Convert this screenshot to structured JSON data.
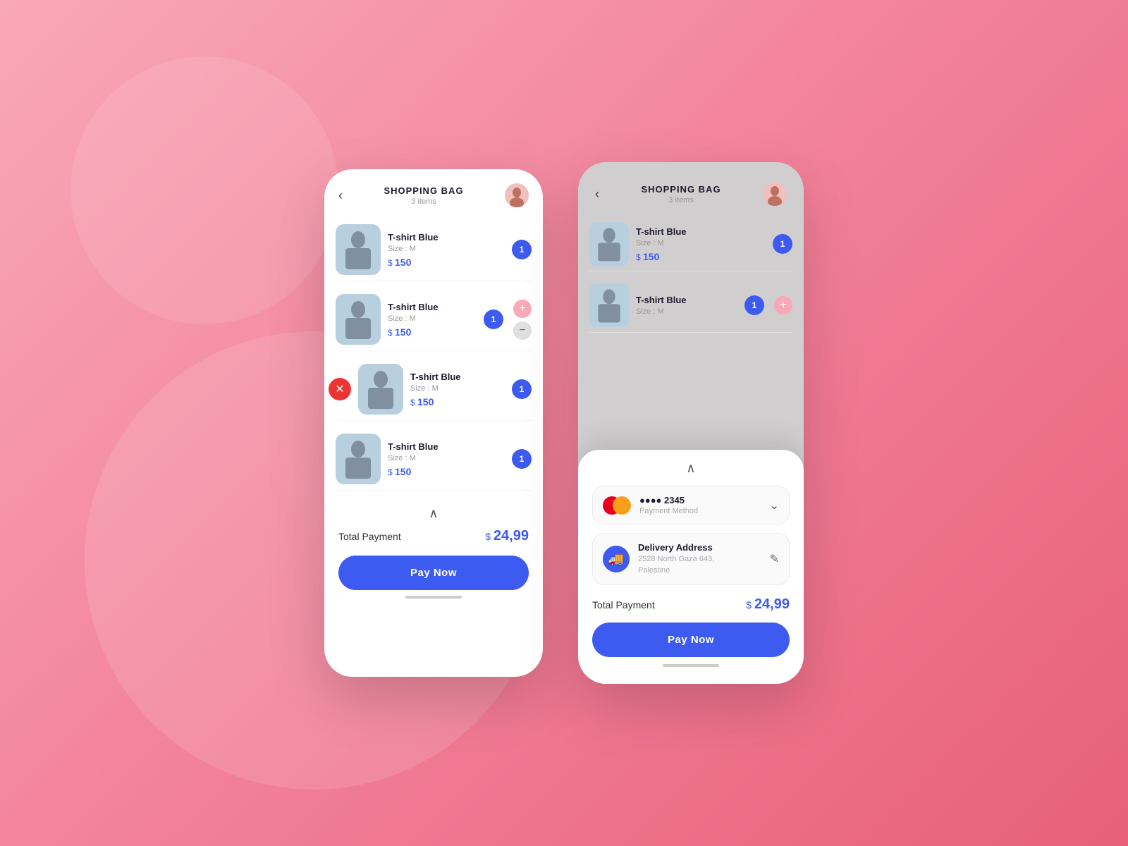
{
  "background": {
    "color_start": "#f9a8b8",
    "color_end": "#e8607a"
  },
  "left_phone": {
    "header": {
      "title": "SHOPPING BAG",
      "subtitle": "3 items",
      "back_label": "‹"
    },
    "items": [
      {
        "name": "T-shirt Blue",
        "size": "Size : M",
        "price": "150",
        "quantity": "1",
        "has_delete": false,
        "has_qty_controls": false
      },
      {
        "name": "T-shirt Blue",
        "size": "Size : M",
        "price": "150",
        "quantity": "1",
        "has_delete": false,
        "has_qty_controls": true
      },
      {
        "name": "T-shirt Blue",
        "size": "Size : M",
        "price": "150",
        "quantity": "1",
        "has_delete": true,
        "has_qty_controls": false
      },
      {
        "name": "T-shirt Blue",
        "size": "Size : M",
        "price": "150",
        "quantity": "1",
        "has_delete": false,
        "has_qty_controls": false
      }
    ],
    "total_label": "Total Payment",
    "total_amount": "24,99",
    "pay_button_label": "Pay Now"
  },
  "right_phone": {
    "header": {
      "title": "SHOPPING BAG",
      "subtitle": "3 items",
      "back_label": "‹"
    },
    "visible_items": [
      {
        "name": "T-shirt Blue",
        "size": "Size : M",
        "price": "150",
        "quantity": "1"
      },
      {
        "name": "T-shirt Blue",
        "size": "Size : M",
        "has_plus": true
      }
    ],
    "payment_sheet": {
      "payment_method": {
        "card_number": "●●●● 2345",
        "label": "Payment Method",
        "dropdown_symbol": "⌄"
      },
      "delivery": {
        "title": "Delivery Address",
        "address_line1": "2528 North Gaza 643,",
        "address_line2": "Palestine"
      },
      "total_label": "Total Payment",
      "total_amount": "24,99",
      "pay_button_label": "Pay Now"
    }
  },
  "icons": {
    "back_arrow": "‹",
    "chevron_up": "∧",
    "edit_pencil": "✎",
    "close_x": "✕",
    "plus": "+",
    "minus": "−",
    "chevron_down": "⌄",
    "delivery_truck": "🚚"
  }
}
